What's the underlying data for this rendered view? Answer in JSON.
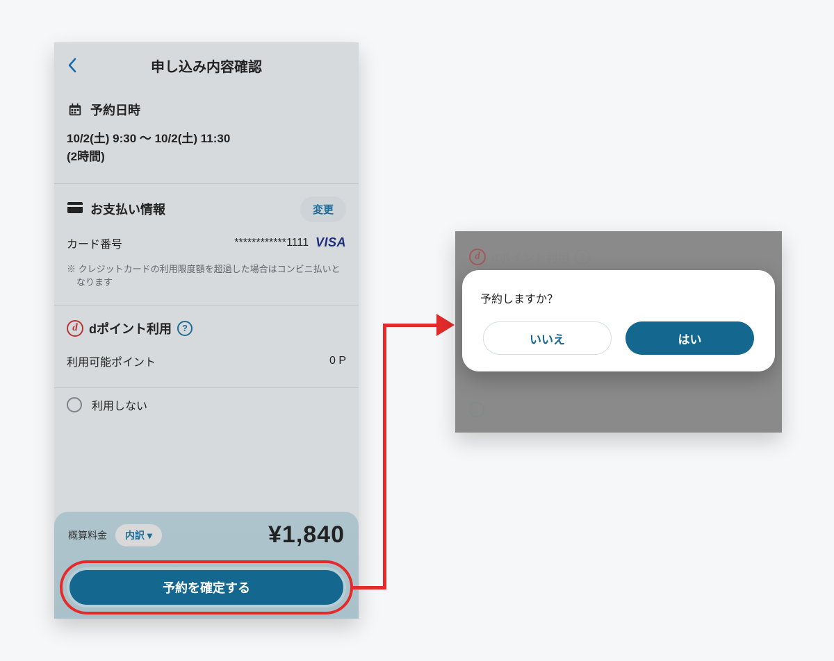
{
  "left": {
    "title": "申し込み内容確認",
    "schedule": {
      "heading": "予約日時",
      "line1": "10/2(土) 9:30 〜 10/2(土) 11:30",
      "line2": "(2時間)"
    },
    "payment": {
      "heading": "お支払い情報",
      "change_label": "変更",
      "card_label": "カード番号",
      "card_value": "************1111",
      "brand": "VISA",
      "note": "※ クレジットカードの利用限度額を超過した場合はコンビニ払いとなります"
    },
    "dpoint": {
      "heading": "dポイント利用",
      "avail_label": "利用可能ポイント",
      "avail_value": "0 P",
      "radio_label": "利用しない"
    },
    "sheet": {
      "estimate_label": "概算料金",
      "breakdown_label": "内訳 ▾",
      "price": "¥1,840",
      "confirm_label": "予約を確定する"
    }
  },
  "right": {
    "bg_heading": "dポイント利用",
    "modal": {
      "question": "予約しますか？",
      "no_label": "いいえ",
      "yes_label": "はい"
    }
  }
}
